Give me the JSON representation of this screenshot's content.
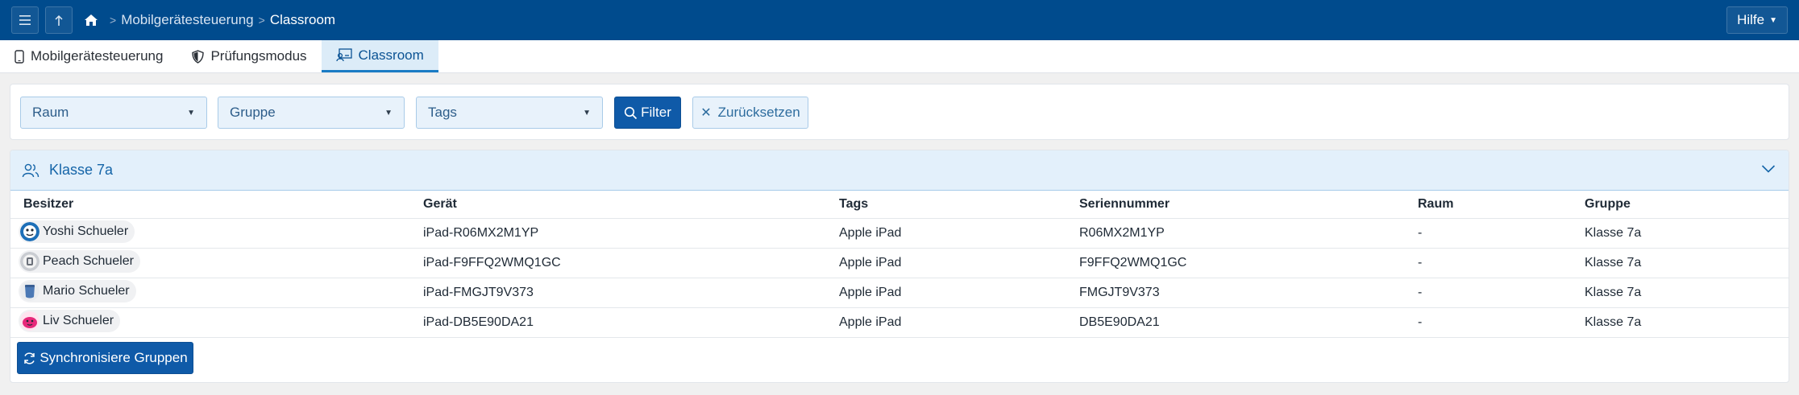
{
  "topbar": {
    "menu_icon": "hamburger-icon",
    "up_icon": "arrow-up-icon",
    "home_icon": "home-icon",
    "breadcrumbs": [
      "Mobilgerätesteuerung",
      "Classroom"
    ],
    "help_label": "Hilfe",
    "bg_color": "#004b8d"
  },
  "tabs": [
    {
      "label": "Mobilgerätesteuerung",
      "icon": "phone-icon",
      "active": false
    },
    {
      "label": "Prüfungsmodus",
      "icon": "shield-icon",
      "active": false
    },
    {
      "label": "Classroom",
      "icon": "classroom-icon",
      "active": true
    }
  ],
  "filters": {
    "room_label": "Raum",
    "group_label": "Gruppe",
    "tags_label": "Tags",
    "filter_button": "Filter",
    "reset_button": "Zurücksetzen"
  },
  "group": {
    "title": "Klasse 7a",
    "icon": "users-icon",
    "columns": [
      "Besitzer",
      "Gerät",
      "Tags",
      "Seriennummer",
      "Raum",
      "Gruppe"
    ],
    "rows": [
      {
        "owner": "Yoshi Schueler",
        "device": "iPad-R06MX2M1YP",
        "tags": "Apple iPad",
        "serial": "R06MX2M1YP",
        "room": "-",
        "group": "Klasse 7a"
      },
      {
        "owner": "Peach Schueler",
        "device": "iPad-F9FFQ2WMQ1GC",
        "tags": "Apple iPad",
        "serial": "F9FFQ2WMQ1GC",
        "room": "-",
        "group": "Klasse 7a"
      },
      {
        "owner": "Mario Schueler",
        "device": "iPad-FMGJT9V373",
        "tags": "Apple iPad",
        "serial": "FMGJT9V373",
        "room": "-",
        "group": "Klasse 7a"
      },
      {
        "owner": "Liv Schueler",
        "device": "iPad-DB5E90DA21",
        "tags": "Apple iPad",
        "serial": "DB5E90DA21",
        "room": "-",
        "group": "Klasse 7a"
      }
    ],
    "sync_button": "Synchronisiere Gruppen"
  }
}
